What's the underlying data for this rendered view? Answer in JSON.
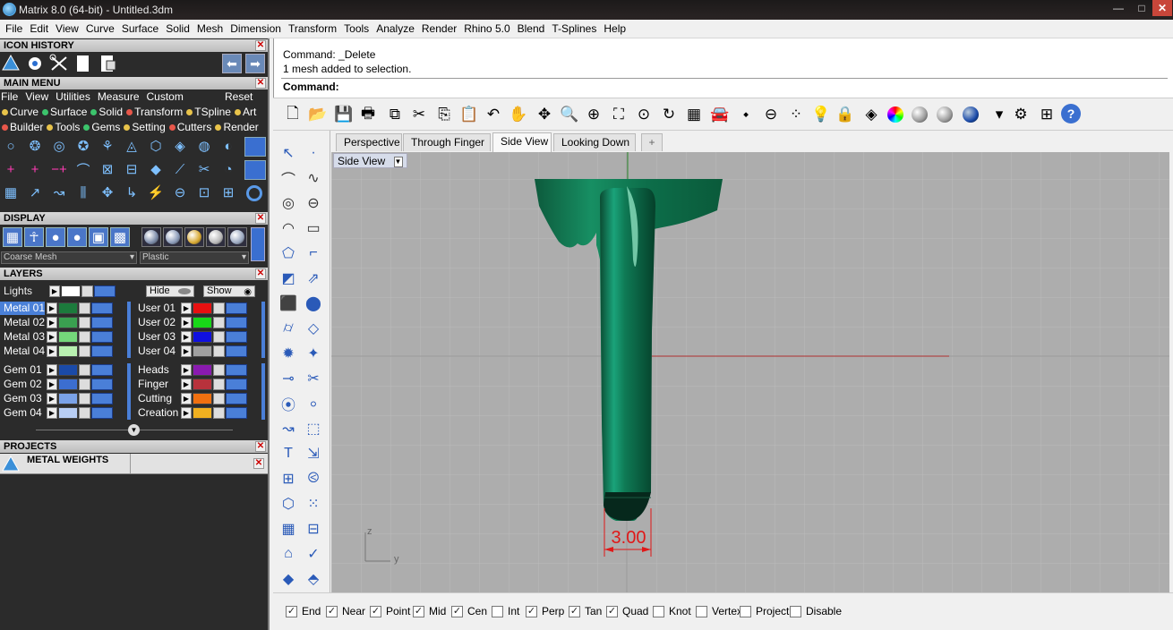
{
  "window": {
    "title": "Matrix 8.0 (64-bit) - Untitled.3dm",
    "minimize": "—",
    "maximize": "□"
  },
  "menubar": [
    "File",
    "Edit",
    "View",
    "Curve",
    "Surface",
    "Solid",
    "Mesh",
    "Dimension",
    "Transform",
    "Tools",
    "Analyze",
    "Render",
    "Rhino 5.0",
    "Blend",
    "T-Splines",
    "Help"
  ],
  "panels": {
    "icon_history": {
      "title": "ICON HISTORY"
    },
    "main_menu": {
      "title": "MAIN MENU",
      "menu_items": [
        "File",
        "View",
        "Utilities",
        "Measure",
        "Custom"
      ],
      "reset": "Reset",
      "row1": [
        {
          "label": "Curve",
          "color": "#e8c34a"
        },
        {
          "label": "Surface",
          "color": "#3cc46c"
        },
        {
          "label": "Solid",
          "color": "#3cc46c"
        },
        {
          "label": "Transform",
          "color": "#e8574a"
        },
        {
          "label": "TSpline",
          "color": "#e8c34a"
        },
        {
          "label": "Art",
          "color": "#e8c34a"
        }
      ],
      "row2": [
        {
          "label": "Builder",
          "color": "#e8574a"
        },
        {
          "label": "Tools",
          "color": "#e8c34a"
        },
        {
          "label": "Gems",
          "color": "#3cc46c"
        },
        {
          "label": "Setting",
          "color": "#e8c34a"
        },
        {
          "label": "Cutters",
          "color": "#e8574a"
        },
        {
          "label": "Render",
          "color": "#e8c34a"
        }
      ]
    },
    "display": {
      "title": "DISPLAY",
      "mesh_select": "Coarse Mesh",
      "material_select": "Plastic"
    },
    "layers": {
      "title": "LAYERS",
      "lights": "Lights",
      "hide": "Hide",
      "show": "Show",
      "left": [
        {
          "name": "Metal 01",
          "color": "#1c7a3c"
        },
        {
          "name": "Metal 02",
          "color": "#3aa050"
        },
        {
          "name": "Metal 03",
          "color": "#74d87a"
        },
        {
          "name": "Metal 04",
          "color": "#b8f0b0"
        },
        {
          "name": "Gem 01",
          "color": "#1a4aa8"
        },
        {
          "name": "Gem 02",
          "color": "#3c6ed0"
        },
        {
          "name": "Gem 03",
          "color": "#7aa2e8"
        },
        {
          "name": "Gem 04",
          "color": "#b8cef4"
        }
      ],
      "right": [
        {
          "name": "User 01",
          "color": "#e81010"
        },
        {
          "name": "User 02",
          "color": "#18d818"
        },
        {
          "name": "User 03",
          "color": "#1010e0"
        },
        {
          "name": "User 04",
          "color": "#a0a0a0"
        },
        {
          "name": "Heads",
          "color": "#8a1ab0"
        },
        {
          "name": "Finger",
          "color": "#b8323c"
        },
        {
          "name": "Cutting",
          "color": "#f07010"
        },
        {
          "name": "Creation",
          "color": "#f0b020"
        }
      ]
    },
    "projects": {
      "title": "PROJECTS",
      "item": "METAL WEIGHTS"
    }
  },
  "command": {
    "line1": "Command: _Delete",
    "line2": "1 mesh added to selection.",
    "prompt": "Command:"
  },
  "tabs": [
    "Perspective",
    "Through Finger",
    "Side View",
    "Looking Down"
  ],
  "active_tab": "Side View",
  "add_tab": "+",
  "viewport": {
    "label": "Side View",
    "axis_z": "z",
    "axis_y": "y",
    "dimension": "3.00"
  },
  "osnaps": [
    {
      "label": "End",
      "checked": true
    },
    {
      "label": "Near",
      "checked": true
    },
    {
      "label": "Point",
      "checked": true
    },
    {
      "label": "Mid",
      "checked": true
    },
    {
      "label": "Cen",
      "checked": true
    },
    {
      "label": "Int",
      "checked": false
    },
    {
      "label": "Perp",
      "checked": true
    },
    {
      "label": "Tan",
      "checked": true
    },
    {
      "label": "Quad",
      "checked": true
    },
    {
      "label": "Knot",
      "checked": false
    },
    {
      "label": "Vertex",
      "checked": false
    },
    {
      "label": "Project",
      "checked": false
    },
    {
      "label": "Disable",
      "checked": false
    }
  ],
  "colors": {
    "model_green": "#0f7a52",
    "dimension_red": "#e01818",
    "viewport_bg": "#adadad"
  }
}
